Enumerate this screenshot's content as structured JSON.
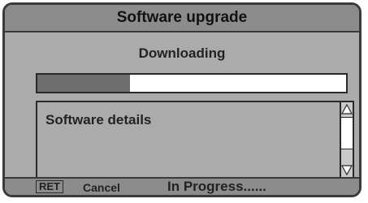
{
  "dialog": {
    "title": "Software upgrade",
    "status_text": "Downloading",
    "progress_fraction": 0.3,
    "details_label": "Software details"
  },
  "footer": {
    "key_label": "RET",
    "cancel_label": "Cancel",
    "status_text": "In Progress......"
  },
  "icons": {
    "scroll_up": "triangle-up-icon",
    "scroll_down": "triangle-down-icon"
  }
}
